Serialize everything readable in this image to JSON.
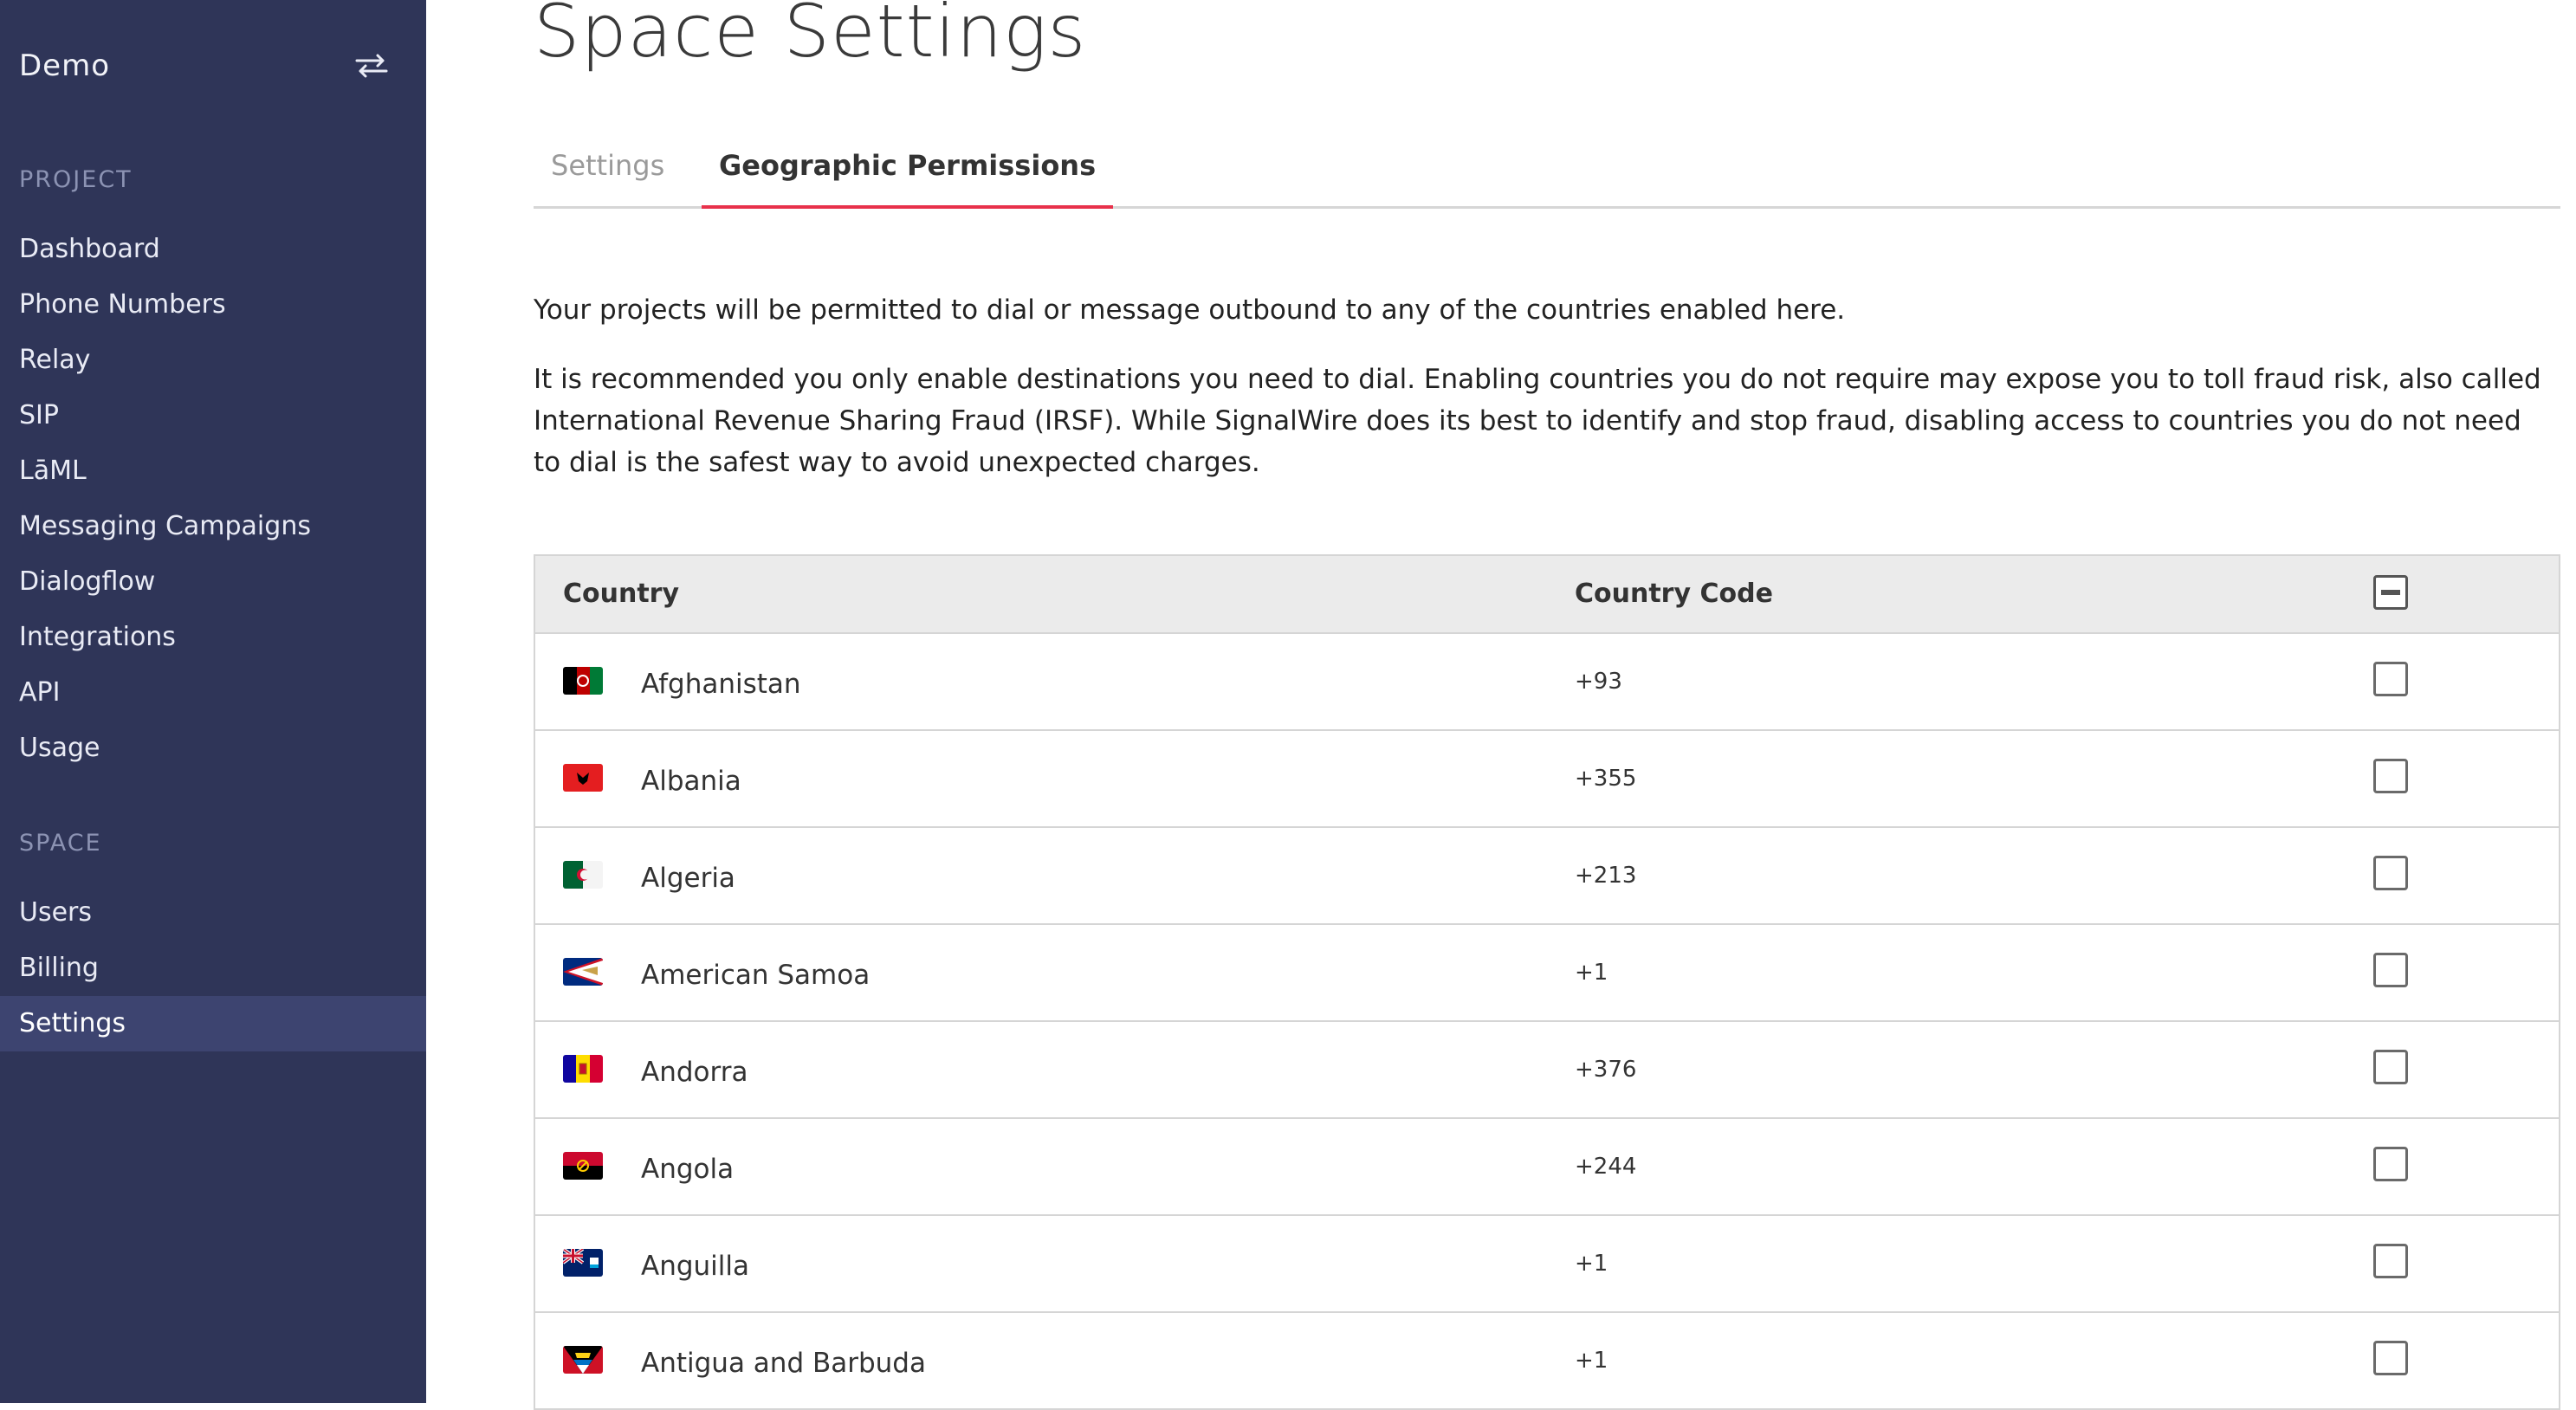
{
  "sidebar": {
    "brand": "Demo",
    "switch_icon": "swap-arrows-icon",
    "project_label": "PROJECT",
    "project_items": [
      {
        "label": "Dashboard"
      },
      {
        "label": "Phone Numbers"
      },
      {
        "label": "Relay"
      },
      {
        "label": "SIP"
      },
      {
        "label": "LāML"
      },
      {
        "label": "Messaging Campaigns"
      },
      {
        "label": "Dialogflow"
      },
      {
        "label": "Integrations"
      },
      {
        "label": "API"
      },
      {
        "label": "Usage"
      }
    ],
    "space_label": "SPACE",
    "space_items": [
      {
        "label": "Users"
      },
      {
        "label": "Billing"
      },
      {
        "label": "Settings",
        "active": true
      }
    ],
    "colors": {
      "background": "#2f3558",
      "active": "#3d4470"
    }
  },
  "main": {
    "title": "Space Settings",
    "tabs": [
      {
        "label": "Settings",
        "active": false
      },
      {
        "label": "Geographic Permissions",
        "active": true
      }
    ],
    "accent_color": "#e8314b",
    "intro": "Your projects will be permitted to dial or message outbound to any of the countries enabled here.",
    "warning": "It is recommended you only enable destinations you need to dial. Enabling countries you do not require may expose you to toll fraud risk, also called International Revenue Sharing Fraud (IRSF). While SignalWire does its best to identify and stop fraud, disabling access to countries you do not need to dial is the safest way to avoid unexpected charges.",
    "table": {
      "headers": {
        "country": "Country",
        "code": "Country Code"
      },
      "select_all_state": "indeterminate",
      "rows": [
        {
          "country": "Afghanistan",
          "code": "+93",
          "flag": "afghanistan-flag-icon",
          "checked": false
        },
        {
          "country": "Albania",
          "code": "+355",
          "flag": "albania-flag-icon",
          "checked": false
        },
        {
          "country": "Algeria",
          "code": "+213",
          "flag": "algeria-flag-icon",
          "checked": false
        },
        {
          "country": "American Samoa",
          "code": "+1",
          "flag": "american-samoa-flag-icon",
          "checked": false
        },
        {
          "country": "Andorra",
          "code": "+376",
          "flag": "andorra-flag-icon",
          "checked": false
        },
        {
          "country": "Angola",
          "code": "+244",
          "flag": "angola-flag-icon",
          "checked": false
        },
        {
          "country": "Anguilla",
          "code": "+1",
          "flag": "anguilla-flag-icon",
          "checked": false
        },
        {
          "country": "Antigua and Barbuda",
          "code": "+1",
          "flag": "antigua-and-barbuda-flag-icon",
          "checked": false
        }
      ]
    }
  }
}
